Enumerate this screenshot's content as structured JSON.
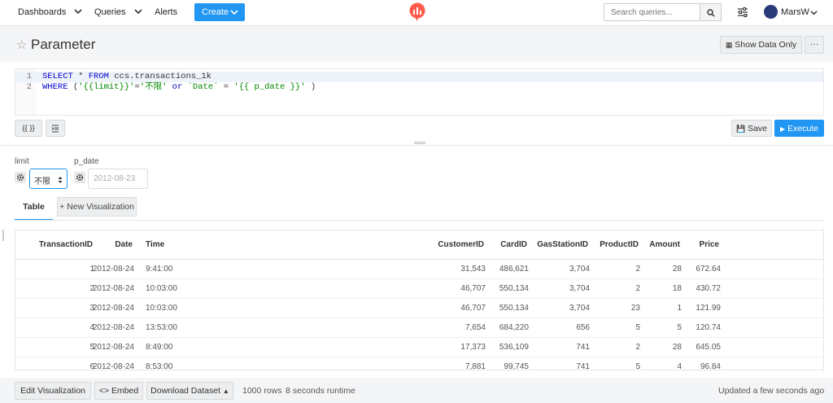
{
  "nav": {
    "dashboards": "Dashboards",
    "queries": "Queries",
    "alerts": "Alerts",
    "create": "Create",
    "search_placeholder": "Search queries...",
    "user": "MarsW",
    "accent": "#2196f3",
    "logo_color": "#ff5b4a"
  },
  "header": {
    "title": "Parameter",
    "show_data_only": "Show Data Only",
    "more": "···"
  },
  "editor": {
    "lines": [
      {
        "num": "1",
        "tokens": [
          [
            "SELECT",
            "kw"
          ],
          [
            " * ",
            "plain"
          ],
          [
            "FROM",
            "kw"
          ],
          [
            " ccs.transactions_1k",
            "plain"
          ]
        ]
      },
      {
        "num": "2",
        "tokens": [
          [
            "WHERE",
            "kw"
          ],
          [
            " (",
            "plain"
          ],
          [
            "'{{limit}}'",
            "str"
          ],
          [
            "=",
            "plain"
          ],
          [
            "'不限'",
            "str"
          ],
          [
            " ",
            "plain"
          ],
          [
            "or",
            "kw"
          ],
          [
            " ",
            "plain"
          ],
          [
            "`Date`",
            "str"
          ],
          [
            " = ",
            "plain"
          ],
          [
            "'{{ p_date }}'",
            "str"
          ],
          [
            " )",
            "plain"
          ]
        ]
      }
    ],
    "params_btn": "{{ }}",
    "save": "Save",
    "execute": "Execute"
  },
  "params": {
    "limit_label": "limit",
    "limit_value": "不限",
    "date_label": "p_date",
    "date_value": "2012-08-23"
  },
  "tabs": {
    "table": "Table",
    "new_viz": "+ New Visualization"
  },
  "table": {
    "columns": [
      "TransactionID",
      "Date",
      "Time",
      "CustomerID",
      "CardID",
      "GasStationID",
      "ProductID",
      "Amount",
      "Price"
    ],
    "rows": [
      [
        "1",
        "2012-08-24",
        "9:41:00",
        "31,543",
        "486,621",
        "3,704",
        "2",
        "28",
        "672.64"
      ],
      [
        "2",
        "2012-08-24",
        "10:03:00",
        "46,707",
        "550,134",
        "3,704",
        "2",
        "18",
        "430.72"
      ],
      [
        "3",
        "2012-08-24",
        "10:03:00",
        "46,707",
        "550,134",
        "3,704",
        "23",
        "1",
        "121.99"
      ],
      [
        "4",
        "2012-08-24",
        "13:53:00",
        "7,654",
        "684,220",
        "656",
        "5",
        "5",
        "120.74"
      ],
      [
        "5",
        "2012-08-24",
        "8:49:00",
        "17,373",
        "536,109",
        "741",
        "2",
        "28",
        "645.05"
      ],
      [
        "6",
        "2012-08-24",
        "8:53:00",
        "7,881",
        "99,745",
        "741",
        "5",
        "4",
        "96.84"
      ]
    ]
  },
  "footer": {
    "edit_viz": "Edit Visualization",
    "embed": "<> Embed",
    "download": "Download Dataset",
    "rows": "1000 rows",
    "runtime": "8 seconds runtime",
    "updated": "Updated a few seconds ago"
  }
}
